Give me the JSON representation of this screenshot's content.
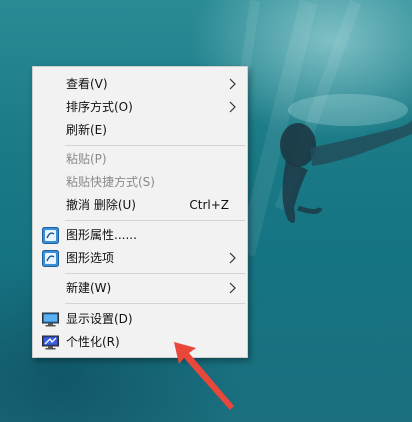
{
  "context_menu": {
    "items": [
      {
        "label": "查看(V)",
        "shortcut": ""
      },
      {
        "label": "排序方式(O)",
        "shortcut": ""
      },
      {
        "label": "刷新(E)",
        "shortcut": ""
      },
      {
        "label": "粘贴(P)",
        "shortcut": ""
      },
      {
        "label": "粘贴快捷方式(S)",
        "shortcut": ""
      },
      {
        "label": "撤消 删除(U)",
        "shortcut": "Ctrl+Z"
      },
      {
        "label": "图形属性......",
        "shortcut": ""
      },
      {
        "label": "图形选项",
        "shortcut": ""
      },
      {
        "label": "新建(W)",
        "shortcut": ""
      },
      {
        "label": "显示设置(D)",
        "shortcut": ""
      },
      {
        "label": "个性化(R)",
        "shortcut": ""
      }
    ]
  },
  "colors": {
    "menu_background": "#f2f2f2",
    "disabled_text": "#8a8a8a",
    "annotation_arrow": "#e8473a",
    "desktop_water": "#1b7886"
  },
  "icons": {
    "graphics_properties": "intel-graphics-icon",
    "graphics_options": "intel-graphics-icon",
    "display_settings": "monitor-icon",
    "personalize": "personalize-monitor-icon"
  }
}
